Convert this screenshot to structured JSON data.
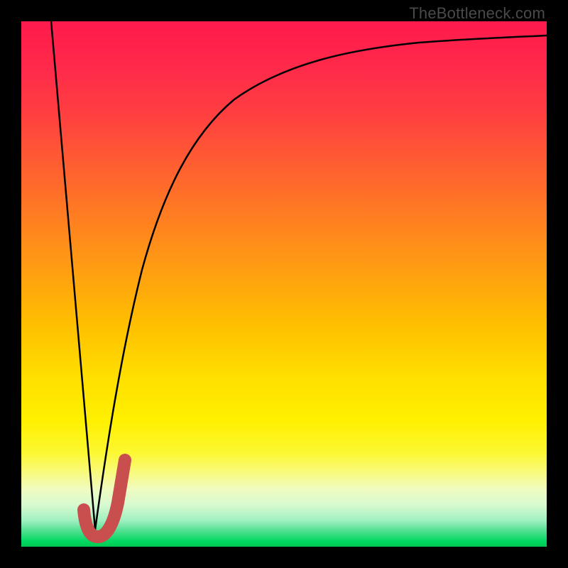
{
  "watermark": "TheBottleneck.com",
  "chart_data": {
    "type": "line",
    "title": "",
    "xlabel": "",
    "ylabel": "",
    "x_range": [
      0,
      100
    ],
    "y_range": [
      0,
      100
    ],
    "series": [
      {
        "name": "descending-line",
        "x": [
          6,
          14
        ],
        "y": [
          100,
          4
        ]
      },
      {
        "name": "ascending-curve",
        "x": [
          14,
          18,
          22,
          28,
          35,
          45,
          58,
          72,
          86,
          100
        ],
        "y": [
          4,
          34,
          52,
          67,
          77,
          85,
          90,
          93,
          95,
          96
        ]
      },
      {
        "name": "bottom-hook-marker",
        "x": [
          12,
          13,
          14,
          16,
          18,
          19.5
        ],
        "y": [
          7,
          3,
          2,
          2.5,
          8,
          17
        ]
      }
    ],
    "colors": {
      "curve": "#000000",
      "hook": "#c94f4f",
      "gradient_top": "#ff1a4c",
      "gradient_bottom": "#00c850"
    }
  }
}
